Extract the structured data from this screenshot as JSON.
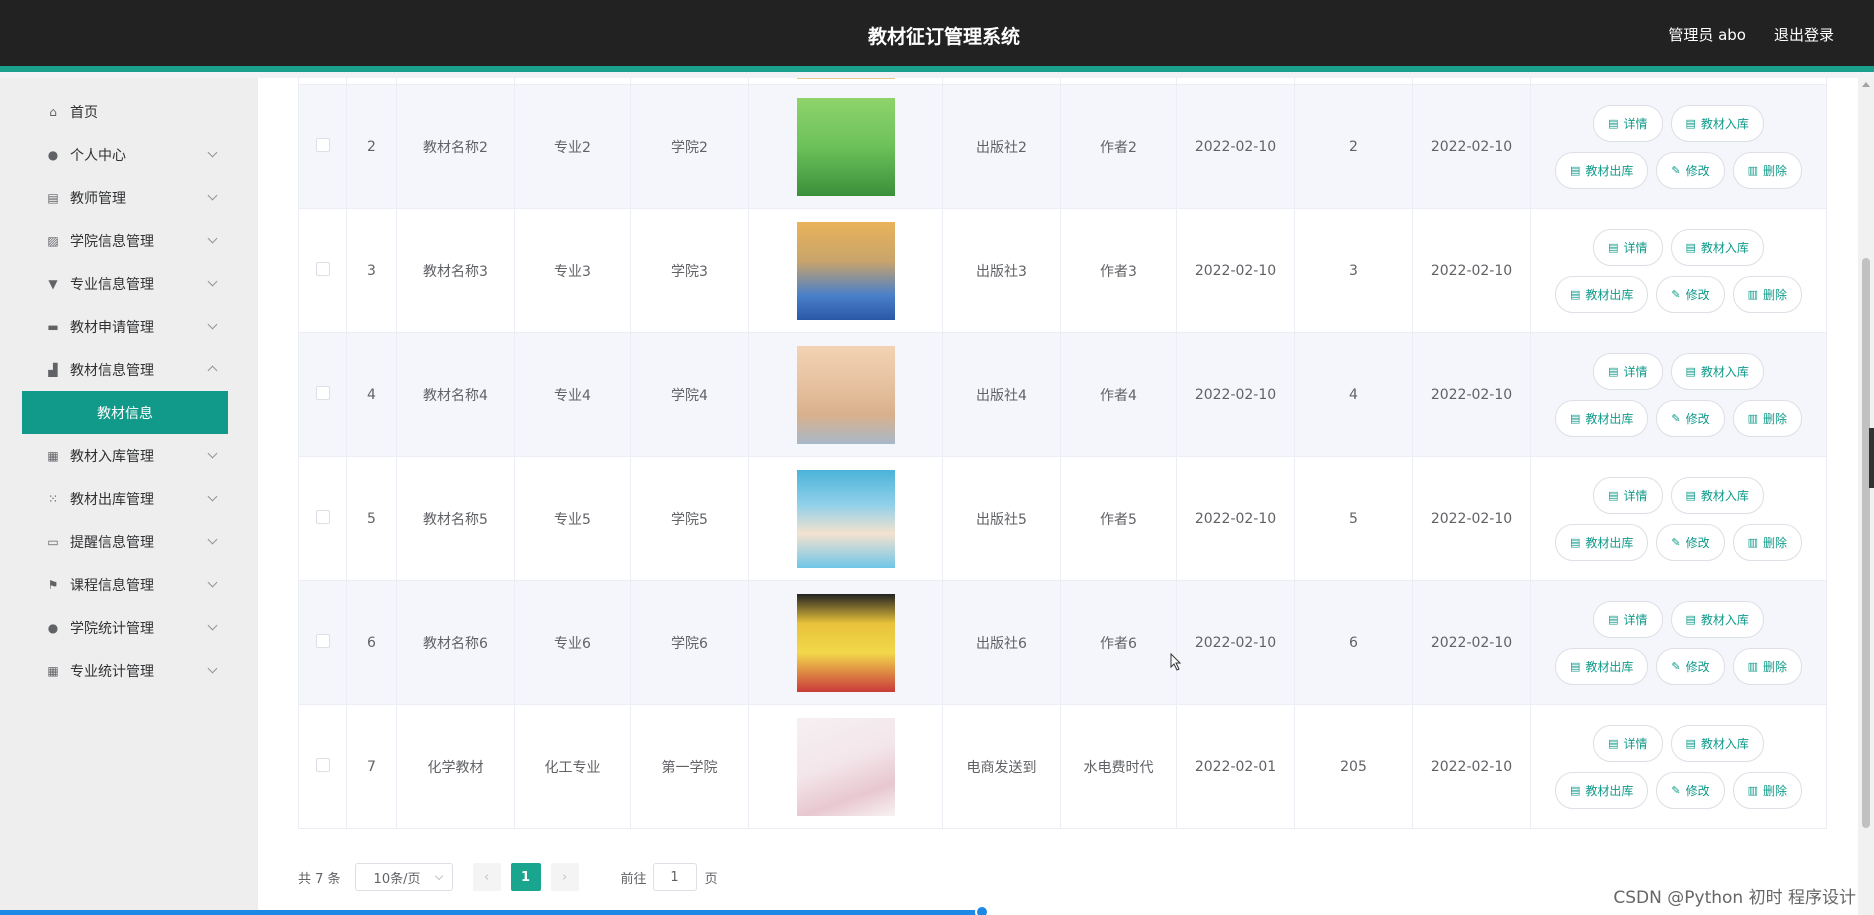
{
  "header": {
    "title": "教材征订管理系统",
    "user": "管理员 abo",
    "logout": "退出登录"
  },
  "sidebar": {
    "items": [
      {
        "label": "首页",
        "icon": "home-icon"
      },
      {
        "label": "个人中心",
        "icon": "user-icon"
      },
      {
        "label": "教师管理",
        "icon": "clipboard-icon"
      },
      {
        "label": "学院信息管理",
        "icon": "chart-icon"
      },
      {
        "label": "专业信息管理",
        "icon": "trophy-icon"
      },
      {
        "label": "教材申请管理",
        "icon": "monitor-icon"
      },
      {
        "label": "教材信息管理",
        "icon": "building-icon"
      },
      {
        "label": "教材信息",
        "icon": ""
      },
      {
        "label": "教材入库管理",
        "icon": "grid-icon"
      },
      {
        "label": "教材出库管理",
        "icon": "grid9-icon"
      },
      {
        "label": "提醒信息管理",
        "icon": "briefcase-icon"
      },
      {
        "label": "课程信息管理",
        "icon": "flag-icon"
      },
      {
        "label": "学院统计管理",
        "icon": "user-icon"
      },
      {
        "label": "专业统计管理",
        "icon": "grid-icon"
      }
    ]
  },
  "table": {
    "rows": [
      {
        "idx": "2",
        "name": "教材名称2",
        "major": "专业2",
        "college": "学院2",
        "publisher": "出版社2",
        "author": "作者2",
        "date": "2022-02-10",
        "qty": "2",
        "date2": "2022-02-10"
      },
      {
        "idx": "3",
        "name": "教材名称3",
        "major": "专业3",
        "college": "学院3",
        "publisher": "出版社3",
        "author": "作者3",
        "date": "2022-02-10",
        "qty": "3",
        "date2": "2022-02-10"
      },
      {
        "idx": "4",
        "name": "教材名称4",
        "major": "专业4",
        "college": "学院4",
        "publisher": "出版社4",
        "author": "作者4",
        "date": "2022-02-10",
        "qty": "4",
        "date2": "2022-02-10"
      },
      {
        "idx": "5",
        "name": "教材名称5",
        "major": "专业5",
        "college": "学院5",
        "publisher": "出版社5",
        "author": "作者5",
        "date": "2022-02-10",
        "qty": "5",
        "date2": "2022-02-10"
      },
      {
        "idx": "6",
        "name": "教材名称6",
        "major": "专业6",
        "college": "学院6",
        "publisher": "出版社6",
        "author": "作者6",
        "date": "2022-02-10",
        "qty": "6",
        "date2": "2022-02-10"
      },
      {
        "idx": "7",
        "name": "化学教材",
        "major": "化工专业",
        "college": "第一学院",
        "publisher": "电商发送到",
        "author": "水电费时代",
        "date": "2022-02-01",
        "qty": "205",
        "date2": "2022-02-10"
      }
    ],
    "actions": {
      "detail": "详情",
      "stock_in": "教材入库",
      "stock_out": "教材出库",
      "edit": "修改",
      "delete": "删除"
    }
  },
  "pagination": {
    "total": "共 7 条",
    "page_size": "10条/页",
    "prev": "‹",
    "current": "1",
    "next": "›",
    "goto_label": "前往",
    "goto_value": "1",
    "page_unit": "页"
  },
  "watermark": "CSDN @Python 初时 程序设计"
}
